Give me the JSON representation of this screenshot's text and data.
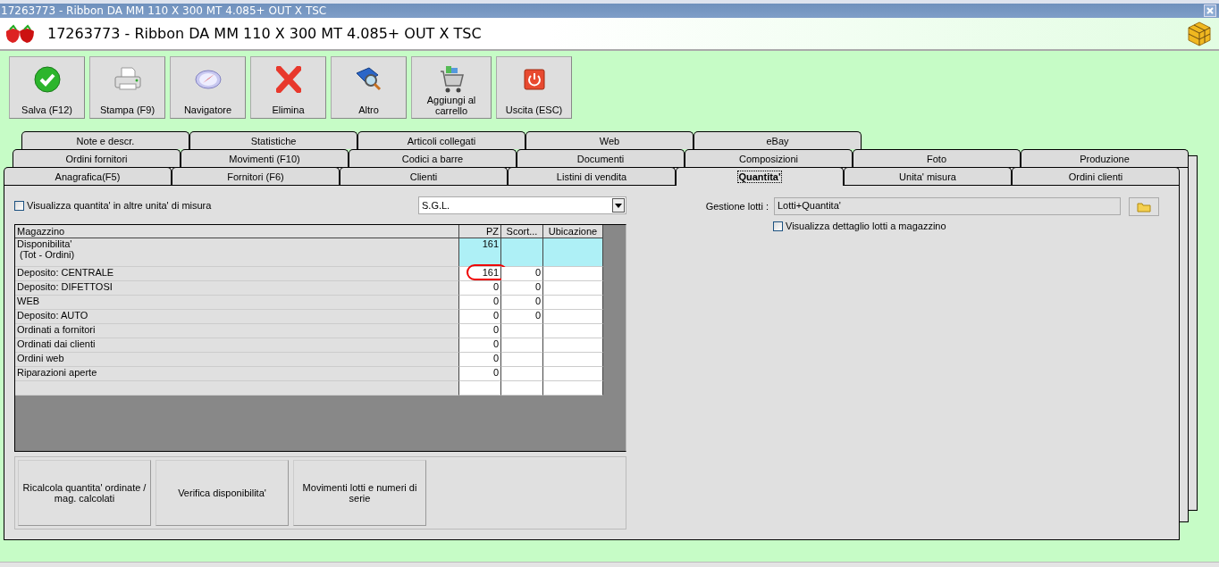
{
  "window": {
    "title": "17263773 - Ribbon DA MM 110 X 300 MT 4.085+ OUT X TSC"
  },
  "header": {
    "title": "17263773 - Ribbon DA MM 110 X 300 MT 4.085+ OUT X TSC"
  },
  "toolbar": [
    {
      "kind": "save",
      "label": "Salva (F12)"
    },
    {
      "kind": "print",
      "label": "Stampa (F9)"
    },
    {
      "kind": "navigator",
      "label": "Navigatore"
    },
    {
      "kind": "delete",
      "label": "Elimina"
    },
    {
      "kind": "more",
      "label": "Altro"
    },
    {
      "kind": "cart",
      "label": "Aggiungi al carrello"
    },
    {
      "kind": "exit",
      "label": "Uscita (ESC)"
    }
  ],
  "tab_rows": [
    {
      "tabs": [
        {
          "label": "Note e descr.",
          "selected": false
        },
        {
          "label": "Statistiche",
          "selected": false
        },
        {
          "label": "Articoli collegati",
          "selected": false
        },
        {
          "label": "Web",
          "selected": false
        },
        {
          "label": "eBay",
          "selected": false
        }
      ]
    },
    {
      "tabs": [
        {
          "label": "Ordini fornitori",
          "selected": false
        },
        {
          "label": "Movimenti (F10)",
          "selected": false
        },
        {
          "label": "Codici a barre",
          "selected": false
        },
        {
          "label": "Documenti",
          "selected": false
        },
        {
          "label": "Composizioni",
          "selected": false
        },
        {
          "label": "Foto",
          "selected": false
        },
        {
          "label": "Produzione",
          "selected": false
        }
      ]
    },
    {
      "tabs": [
        {
          "label": "Anagrafica(F5)",
          "selected": false
        },
        {
          "label": "Fornitori (F6)",
          "selected": false
        },
        {
          "label": "Clienti",
          "selected": false
        },
        {
          "label": "Listini di vendita",
          "selected": false
        },
        {
          "label": "Quantita'",
          "selected": true
        },
        {
          "label": "Unita' misura",
          "selected": false
        },
        {
          "label": "Ordini clienti",
          "selected": false
        }
      ]
    }
  ],
  "panel": {
    "show_other_units": {
      "label": "Visualizza quantita' in altre unita' di misura",
      "checked": false
    },
    "unit_select": {
      "value": "S.G.L."
    },
    "table": {
      "columns": [
        "Magazzino",
        "PZ",
        "Scort...",
        "Ubicazione"
      ],
      "rows": [
        {
          "name": "Disponibilita'",
          "note": "(Tot - Ordini)",
          "pz": "161",
          "scorta": "",
          "highlighted": true,
          "circled": false
        },
        {
          "name": "Deposito: CENTRALE",
          "pz": "161",
          "scorta": "0",
          "highlighted": false,
          "circled": true
        },
        {
          "name": "Deposito: DIFETTOSI",
          "pz": "0",
          "scorta": "0",
          "highlighted": false,
          "circled": false
        },
        {
          "name": "WEB",
          "pz": "0",
          "scorta": "0",
          "highlighted": false,
          "circled": false
        },
        {
          "name": "Deposito: AUTO",
          "pz": "0",
          "scorta": "0",
          "highlighted": false,
          "circled": false
        },
        {
          "name": "Ordinati a fornitori",
          "pz": "0",
          "scorta": "",
          "highlighted": false,
          "circled": false
        },
        {
          "name": "Ordinati dai clienti",
          "pz": "0",
          "scorta": "",
          "highlighted": false,
          "circled": false
        },
        {
          "name": "Ordini web",
          "pz": "0",
          "scorta": "",
          "highlighted": false,
          "circled": false
        },
        {
          "name": "Riparazioni aperte",
          "pz": "0",
          "scorta": "",
          "highlighted": false,
          "circled": false
        }
      ]
    },
    "actions": [
      "Ricalcola quantita' ordinate / mag. calcolati",
      "Verifica disponibilita'",
      "Movimenti lotti e numeri di serie"
    ],
    "lots": {
      "label": "Gestione lotti :",
      "value": "Lotti+Quantita'",
      "detail": {
        "label": "Visualizza dettaglio lotti a magazzino",
        "checked": false
      }
    }
  }
}
